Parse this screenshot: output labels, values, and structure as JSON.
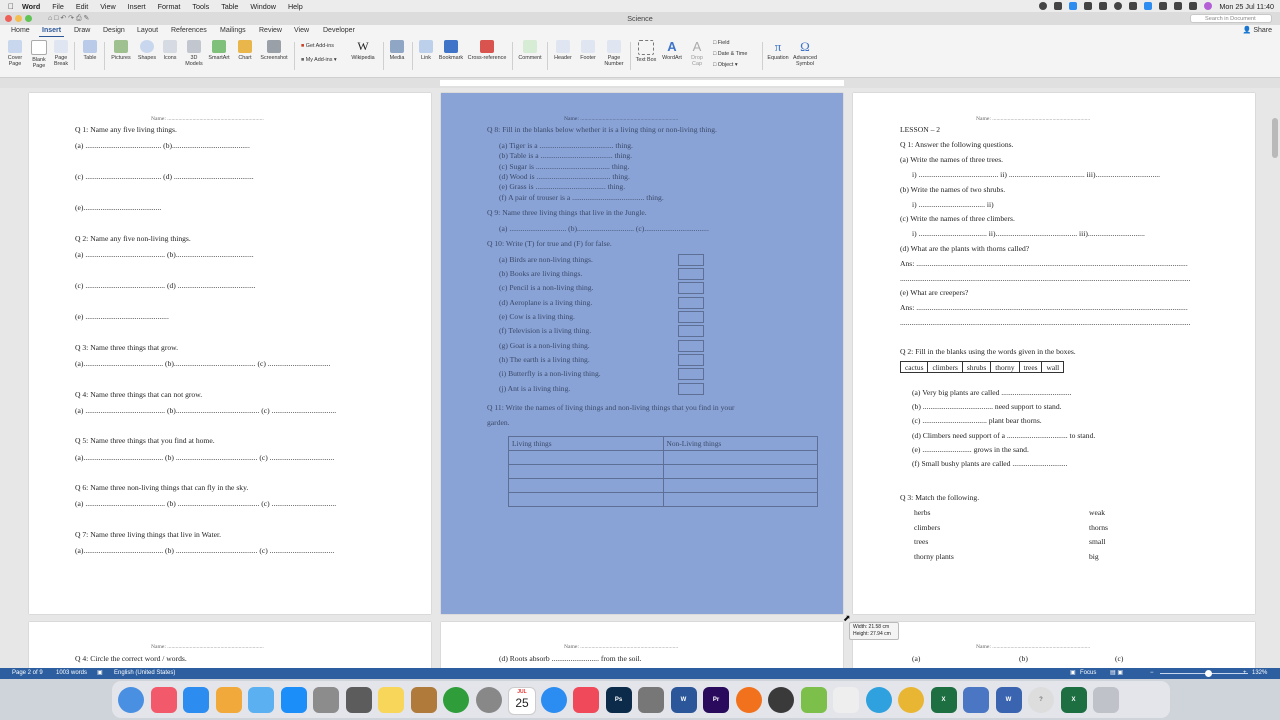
{
  "menubar": {
    "app": "Word",
    "items": [
      "File",
      "Edit",
      "View",
      "Insert",
      "Format",
      "Tools",
      "Table",
      "Window",
      "Help"
    ],
    "clock": "Mon 25 Jul  11:40"
  },
  "window": {
    "title": "Science",
    "search_placeholder": "Search in Document"
  },
  "ribbon": {
    "tabs": [
      "Home",
      "Insert",
      "Draw",
      "Design",
      "Layout",
      "References",
      "Mailings",
      "Review",
      "View",
      "Developer"
    ],
    "active_tab": "Insert",
    "share_label": "Share",
    "buttons": [
      "Cover Page",
      "Blank Page",
      "Page Break",
      "Table",
      "Pictures",
      "Shapes",
      "Icons",
      "3D Models",
      "SmartArt",
      "Chart",
      "Screenshot",
      "Get Add-ins",
      "My Add-ins",
      "Wikipedia",
      "Media",
      "Link",
      "Bookmark",
      "Cross-reference",
      "Comment",
      "Header",
      "Footer",
      "Page Number",
      "Text Box",
      "WordArt",
      "Drop Cap",
      "Field",
      "Date & Time",
      "Object",
      "Equation",
      "Advanced Symbol"
    ]
  },
  "page1": {
    "name": "Name: .....................................................................",
    "lines": [
      "Q 1: Name any five living things.",
      "(a) ........................................     (b).........................................",
      "(c) ........................................     (d) ..........................................",
      "(e).........................................",
      "Q 2: Name any five non-living things.",
      "(a) ..........................................       (b).........................................",
      "(c) ..........................................       (d) .........................................",
      "(e) ............................................",
      "Q 3: Name three things that grow.",
      "(a)..........................................       (b)...........................................      (c) .................................",
      "Q 4: Name three things that can not grow.",
      "(a) ..........................................       (b)............................................     (c) ..................................",
      "Q 5: Name three things that you find at home.",
      "(a)..........................................       (b) ...........................................     (c) ..................................",
      "Q 6: Name three non-living things that can fly in the sky.",
      "(a) ..........................................       (b) ...........................................     (c) ..................................",
      "Q 7: Name three living things that live in Water.",
      "(a)..........................................       (b) ...........................................     (c) .................................."
    ]
  },
  "page2": {
    "name": "Name: ......................................................................",
    "lines": [
      "Q 8: Fill in the blanks below whether it is a living thing or non-living thing.",
      "(a)  Tiger is a ....................................... thing.",
      "(b)  Table is a ...................................... thing.",
      "(c)  Sugar is ....................................... thing.",
      "(d)  Wood is ....................................... thing.",
      "(e)  Grass is ..................................... thing.",
      "(f)   A pair of trouser is a ...................................... thing.",
      "Q 9: Name three living things that live in the Jungle.",
      "(a)  ..............................       (b)..............................     (c)..................................",
      "Q 10: Write (T) for true and (F) for false.",
      "(a)  Birds are non-living things.",
      "(b)  Books are living things.",
      "(c)  Pencil is a non-living thing.",
      "(d)  Aeroplane is a living thing.",
      "(e)  Cow is a living thing.",
      "(f)   Television is a living thing.",
      "(g)  Goat is a non-living thing.",
      "(h)  The earth is a living thing.",
      "(i)   Butterfly is a non-living thing.",
      "(j)   Ant is a living thing.",
      "Q 11: Write the names of living things and non-living things that you find in your",
      "garden."
    ],
    "table_headers": [
      "Living things",
      "Non-Living things"
    ]
  },
  "page3": {
    "name": "Name: ......................................................................",
    "lines": [
      "LESSON – 2",
      "Q 1: Answer the following questions.",
      "(a) Write the names of three trees.",
      "i) ..........................................      ii) ........................................      iii)..................................",
      "(b) Write the names of two shrubs.",
      "i) ...................................         ii)",
      "(c) Write the names of three climbers.",
      "i) ....................................         ii)...........................................         iii)..............................",
      "(d) What are the plants with thorns called?",
      "Ans: ...............................................................................................................................................",
      ".........................................................................................................................................................",
      "(e) What are creepers?",
      "Ans: ...............................................................................................................................................",
      ".........................................................................................................................................................",
      "Q 2: Fill in the blanks using the words given in the boxes.",
      "(a)  Very big plants are called .....................................",
      "(b)  ..................................... need support to stand.",
      "(c)  .................................. plant bear thorns.",
      "(d)  Climbers need support of a ................................ to stand.",
      "(e)  .......................... grows in the sand.",
      "(f)   Small bushy plants are called .............................",
      "Q 3: Match the following."
    ],
    "word_box": [
      "cactus",
      "climbers",
      "shrubs",
      "thorny",
      "trees",
      "wall"
    ],
    "match_left": [
      "herbs",
      "climbers",
      "trees",
      "thorny plants"
    ],
    "match_right": [
      "weak",
      "thorns",
      "small",
      "big"
    ]
  },
  "page4": {
    "name": "Name: .....................................................................",
    "line": "Q 4: Circle the correct word / words."
  },
  "page5": {
    "name": "Name: ......................................................................",
    "line": "(d) Roots absorb ......................... from the soil."
  },
  "page6": {
    "name": "Name: ......................................................................",
    "items": [
      "(a)",
      "(b)",
      "(c)"
    ]
  },
  "size_tooltip": {
    "width": "Width: 21.58 cm",
    "height": "Height: 27.94 cm"
  },
  "statusbar": {
    "page": "Page 2 of 9",
    "words": "1003 words",
    "language": "English (United States)",
    "focus": "Focus",
    "zoom": "132%",
    "zoom_level": 0.55
  },
  "dock": {
    "apps": [
      "Finder",
      "Music",
      "Zoom",
      "Photos",
      "Mail",
      "App Store",
      "Launchpad",
      "Calculator",
      "Notes",
      "Archive",
      "uTorrent",
      "System Preferences",
      "Calendar",
      "Safari",
      "News",
      "Photoshop",
      "Screenshot",
      "Word",
      "Premiere",
      "Firefox",
      "QuickTime",
      "Android File Transfer",
      "TextEdit",
      "Telegram",
      "Chrome",
      "Excel",
      "Preview",
      "Word Document",
      "Help",
      "Excel Document",
      "Trash"
    ],
    "calendar_month": "JUL",
    "calendar_day": "25"
  },
  "colors": {
    "selection": "#8aa3d6",
    "accent": "#2b5797",
    "statusbar": "#2d5fa0"
  }
}
